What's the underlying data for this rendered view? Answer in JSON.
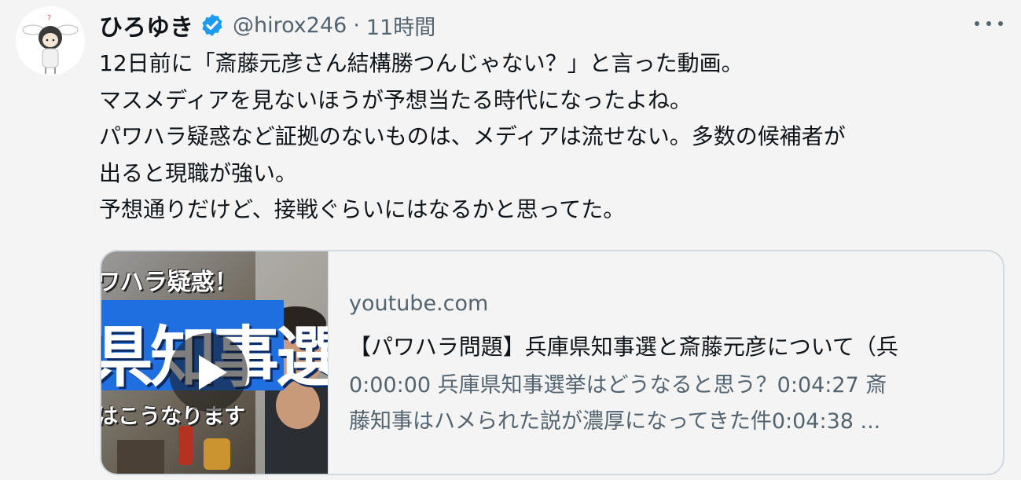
{
  "author": {
    "display_name": "ひろゆき",
    "handle": "@hirox246",
    "separator": "·",
    "time": "11時間",
    "verified_color": "#1d9bf0"
  },
  "tweet": {
    "lines": [
      "12日前に「斎藤元彦さん結構勝つんじゃない？」と言った動画。",
      "マスメディアを見ないほうが予想当たる時代になったよね。",
      "パワハラ疑惑など証拠のないものは、メディアは流せない。多数の候補者が",
      "出ると現職が強い。",
      "予想通りだけど、接戦ぐらいにはなるかと思ってた。"
    ]
  },
  "card": {
    "thumbnail": {
      "top_text": "ワハラ疑惑！",
      "big_text": "県知事選",
      "bottom_text": "はこうなります"
    },
    "domain": "youtube.com",
    "title": "【パワハラ問題】兵庫県知事選と斎藤元彦について（兵",
    "description_lines": [
      "0:00:00 兵庫県知事選挙はどうなると思う？0:04:27 斎",
      "藤知事はハメられた説が濃厚になってきた件0:04:38 ..."
    ]
  },
  "icons": {
    "avatar": "avatar-image",
    "verified": "verified-badge-icon",
    "more": "more-options-icon",
    "play": "play-icon"
  }
}
